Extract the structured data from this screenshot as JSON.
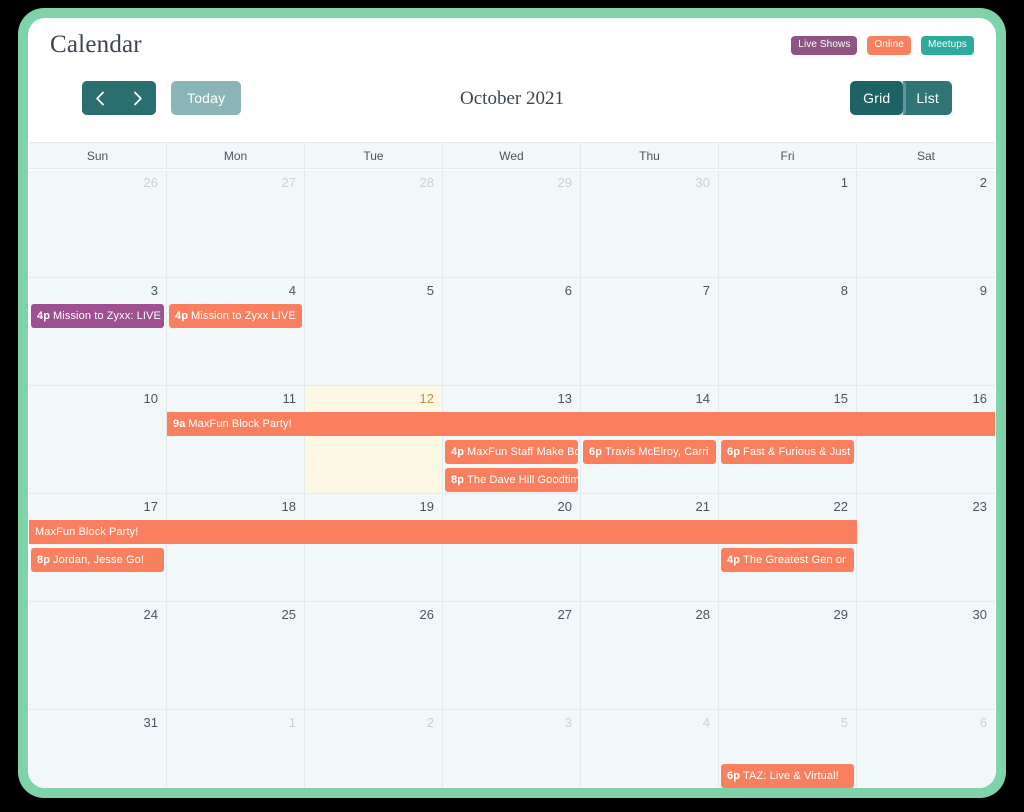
{
  "page": {
    "title": "Calendar",
    "colors": {
      "frame_green": "#7ed3a8",
      "teal_dark": "#1d6264",
      "teal_mid": "#2b6e70",
      "teal_light": "#8ab4b5",
      "event_purple": "#9e5090",
      "event_coral": "#fa7f5e",
      "badge_teal": "#2eab9e",
      "today_bg": "#fdf8e4",
      "cell_bg": "#f2f8f9",
      "grid_line": "#e3eaec"
    }
  },
  "legend": [
    {
      "label": "Live Shows",
      "color": "#8e5584"
    },
    {
      "label": "Online",
      "color": "#fa7f5e"
    },
    {
      "label": "Meetups",
      "color": "#2eab9e"
    }
  ],
  "toolbar": {
    "prev_icon": "chevron-left-icon",
    "next_icon": "chevron-right-icon",
    "today_label": "Today",
    "month_title": "October 2021",
    "views": [
      {
        "label": "Grid",
        "active": true
      },
      {
        "label": "List",
        "active": false
      }
    ]
  },
  "weekdays": [
    "Sun",
    "Mon",
    "Tue",
    "Wed",
    "Thu",
    "Fri",
    "Sat"
  ],
  "weeks": [
    {
      "days": [
        {
          "n": "26",
          "other": true
        },
        {
          "n": "27",
          "other": true
        },
        {
          "n": "28",
          "other": true
        },
        {
          "n": "29",
          "other": true
        },
        {
          "n": "30",
          "other": true
        },
        {
          "n": "1",
          "other": false
        },
        {
          "n": "2",
          "other": false
        }
      ],
      "events": []
    },
    {
      "days": [
        {
          "n": "3",
          "other": false
        },
        {
          "n": "4",
          "other": false
        },
        {
          "n": "5",
          "other": false
        },
        {
          "n": "6",
          "other": false
        },
        {
          "n": "7",
          "other": false
        },
        {
          "n": "8",
          "other": false
        },
        {
          "n": "9",
          "other": false
        }
      ],
      "events": [
        {
          "time": "4p",
          "title": "Mission to Zyxx: LIVE",
          "color": "#9e5090",
          "start": 0,
          "span": 1,
          "row": 0
        },
        {
          "time": "4p",
          "title": "Mission to Zyxx LIVE",
          "color": "#fa7f5e",
          "start": 1,
          "span": 1,
          "row": 0
        }
      ]
    },
    {
      "days": [
        {
          "n": "10",
          "other": false
        },
        {
          "n": "11",
          "other": false
        },
        {
          "n": "12",
          "other": false,
          "today": true
        },
        {
          "n": "13",
          "other": false
        },
        {
          "n": "14",
          "other": false
        },
        {
          "n": "15",
          "other": false
        },
        {
          "n": "16",
          "other": false
        }
      ],
      "events": [
        {
          "time": "9a",
          "title": "MaxFun Block Party!",
          "color": "#fa7f5e",
          "start": 1,
          "span": 6,
          "row": 0,
          "bar": true
        },
        {
          "time": "4p",
          "title": "MaxFun Staff Make Boo",
          "color": "#fa7f5e",
          "start": 3,
          "span": 1,
          "row": 1
        },
        {
          "time": "6p",
          "title": "Travis McElroy, Carri",
          "color": "#fa7f5e",
          "start": 4,
          "span": 1,
          "row": 1
        },
        {
          "time": "6p",
          "title": "Fast & Furious & Just",
          "color": "#fa7f5e",
          "start": 5,
          "span": 1,
          "row": 1
        },
        {
          "time": "8p",
          "title": "The Dave Hill Goodtim",
          "color": "#fa7f5e",
          "start": 3,
          "span": 1,
          "row": 2
        }
      ]
    },
    {
      "days": [
        {
          "n": "17",
          "other": false
        },
        {
          "n": "18",
          "other": false
        },
        {
          "n": "19",
          "other": false
        },
        {
          "n": "20",
          "other": false
        },
        {
          "n": "21",
          "other": false
        },
        {
          "n": "22",
          "other": false
        },
        {
          "n": "23",
          "other": false
        }
      ],
      "events": [
        {
          "time": "",
          "title": "MaxFun Block Party!",
          "color": "#fa7f5e",
          "start": 0,
          "span": 6,
          "row": 0,
          "bar": true
        },
        {
          "time": "8p",
          "title": "Jordan, Jesse Go!",
          "color": "#fa7f5e",
          "start": 0,
          "span": 1,
          "row": 1
        },
        {
          "time": "4p",
          "title": "The Greatest Gen or",
          "color": "#fa7f5e",
          "start": 5,
          "span": 1,
          "row": 1
        }
      ]
    },
    {
      "days": [
        {
          "n": "24",
          "other": false
        },
        {
          "n": "25",
          "other": false
        },
        {
          "n": "26",
          "other": false
        },
        {
          "n": "27",
          "other": false
        },
        {
          "n": "28",
          "other": false
        },
        {
          "n": "29",
          "other": false
        },
        {
          "n": "30",
          "other": false
        }
      ],
      "events": []
    },
    {
      "days": [
        {
          "n": "31",
          "other": false
        },
        {
          "n": "1",
          "other": true
        },
        {
          "n": "2",
          "other": true
        },
        {
          "n": "3",
          "other": true
        },
        {
          "n": "4",
          "other": true
        },
        {
          "n": "5",
          "other": true
        },
        {
          "n": "6",
          "other": true
        }
      ],
      "events": [
        {
          "time": "6p",
          "title": "TAZ: Live & Virtual!",
          "color": "#fa7f5e",
          "start": 5,
          "span": 1,
          "row": 1
        }
      ]
    }
  ]
}
